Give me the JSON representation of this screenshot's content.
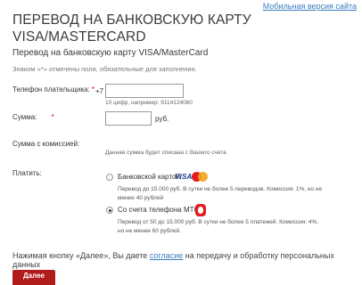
{
  "top_link": "Мобильная версия сайта",
  "title_line1": "ПЕРЕВОД НА БАНКОВСКУЮ КАРТУ",
  "title_line2": "VISA/MASTERCARD",
  "subtitle": "Перевод на банковскую карту VISA/MasterCard",
  "required_note": "Знаком «*» отмечены поля, обязательные для заполнения.",
  "phone": {
    "label": "Телефон плательщика:",
    "required_mark": "*",
    "prefix": "+7",
    "value": "",
    "hint": "10 цифр, например: 9114124060"
  },
  "amount": {
    "label": "Сумма:",
    "required_mark": "*",
    "value": "",
    "unit": "руб."
  },
  "commission": {
    "label": "Сумма с комиссией:",
    "note": "Данная сумма будет списана с Вашего счета"
  },
  "payment": {
    "label": "Платить:",
    "options": [
      {
        "label": "Банковской картой",
        "selected": false,
        "description": "Перевод до 15.000 руб. В сутки не более 5 переводов. Комиссия: 1%, но не менее 40 рублей",
        "logo_text": "VISA",
        "icon": "visa-mastercard-logos"
      },
      {
        "label": "Со счета телефона МТС",
        "selected": true,
        "description": "Перевод от 50 до 15.000 руб. В сутки не более 5 платежей. Комиссия: 4%, но не менее 60 рублей.",
        "icon": "mts-egg-logo"
      }
    ]
  },
  "consent": {
    "before": "Нажимая кнопку «Далее», Вы даете ",
    "link": "согласие",
    "after": " на передачу и обработку персональных данных"
  },
  "next_button": "Далее",
  "colors": {
    "link": "#3a7bbf",
    "button": "#b01c1c",
    "required": "#cc0000",
    "mts": "#e31e24"
  }
}
